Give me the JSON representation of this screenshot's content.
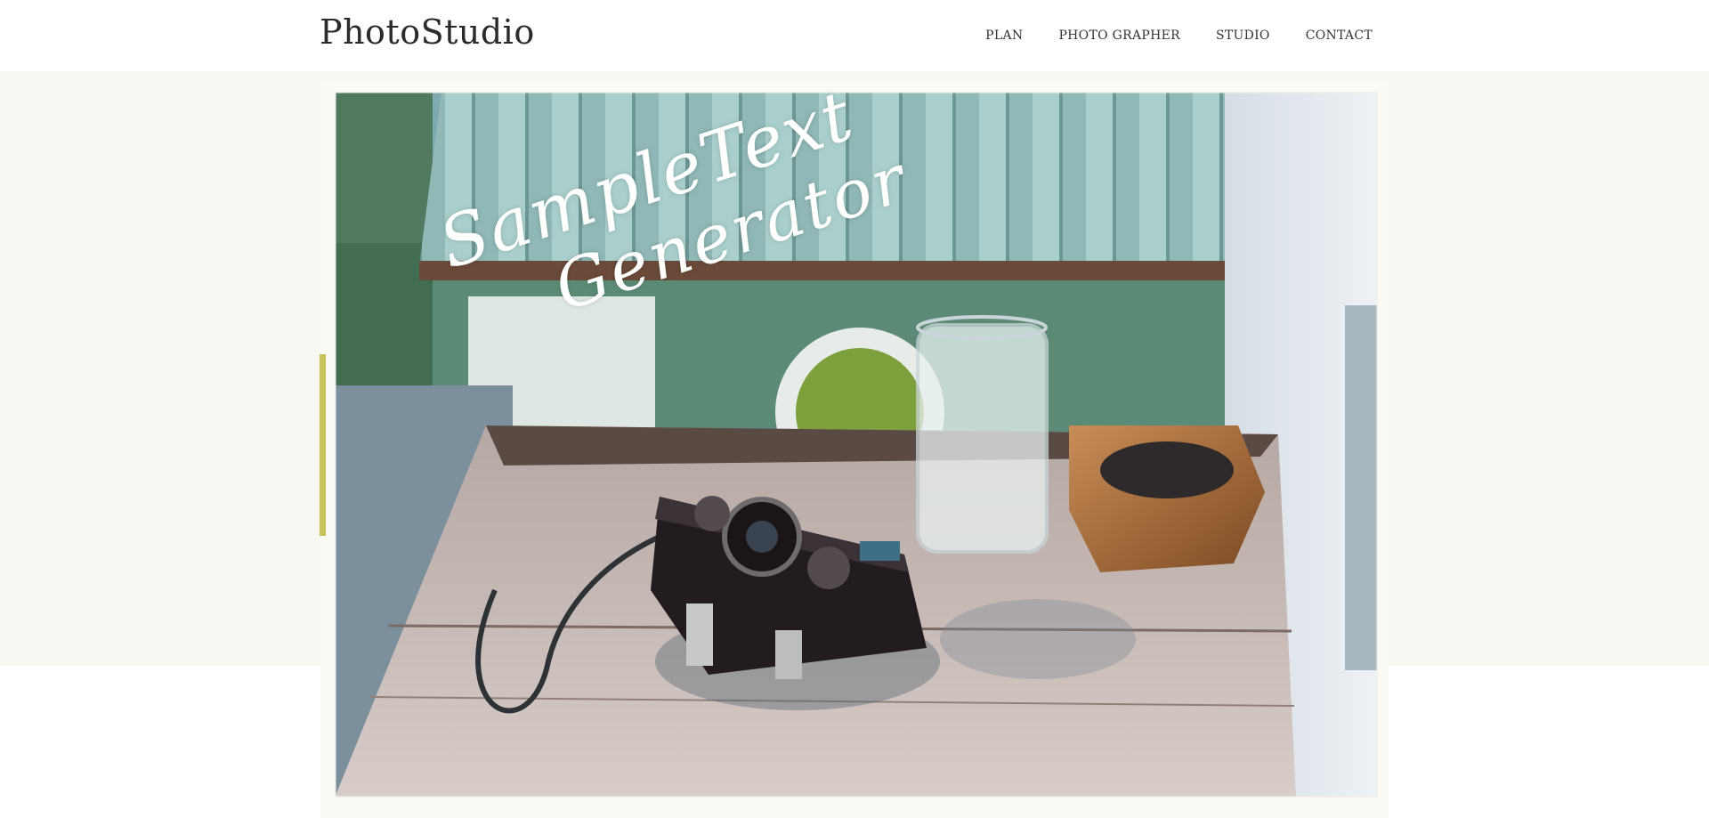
{
  "brand": {
    "logo_text": "PhotoStudio"
  },
  "nav": {
    "items": [
      {
        "label": "PLAN"
      },
      {
        "label": "PHOTO GRAPHER"
      },
      {
        "label": "STUDIO"
      },
      {
        "label": "CONTACT"
      }
    ]
  },
  "hero": {
    "headline_line1": "SampleText",
    "headline_line2": "Generator",
    "image_subject": "camera-glass-ashtray-on-wooden-tray"
  },
  "colors": {
    "background": "#ffffff",
    "hero_band": "#f8f7f2",
    "accent": "#c5c25c",
    "text_dark": "#2b2b2b"
  }
}
